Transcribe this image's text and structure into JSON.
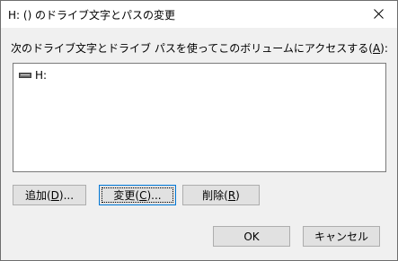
{
  "dialog": {
    "title": "H: () のドライブ文字とパスの変更",
    "prompt_before": "次のドライブ文字とドライブ パスを使ってこのボリュームにアクセスする(",
    "prompt_mnemonic": "A",
    "prompt_after": "):"
  },
  "list": {
    "items": [
      {
        "label": "H:",
        "icon": "drive-icon"
      }
    ]
  },
  "buttons": {
    "add": {
      "before": "追加(",
      "mnemonic": "D",
      "after": ")..."
    },
    "change": {
      "before": "変更(",
      "mnemonic": "C",
      "after": ")..."
    },
    "remove": {
      "before": "削除(",
      "mnemonic": "R",
      "after": ")"
    },
    "ok": "OK",
    "cancel": "キャンセル"
  },
  "colors": {
    "focus_border": "#0078d7",
    "button_face": "#e1e1e1",
    "dialog_bg": "#f0f0f0"
  }
}
